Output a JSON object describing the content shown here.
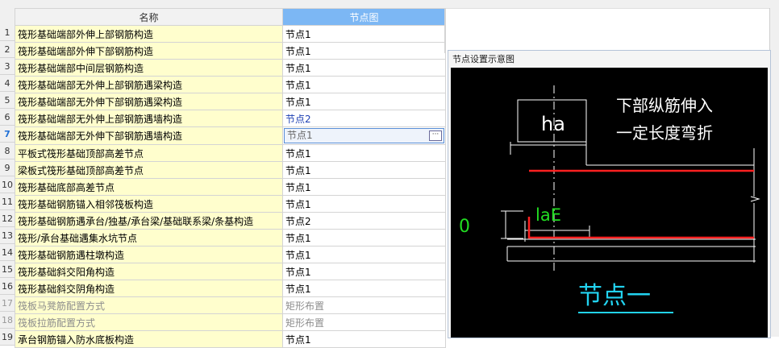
{
  "table": {
    "col_name": "名称",
    "col_node": "节点图",
    "rows": [
      {
        "num": "1",
        "name": "筏形基础端部外伸上部钢筋构造",
        "node": "节点1"
      },
      {
        "num": "2",
        "name": "筏形基础端部外伸下部钢筋构造",
        "node": "节点1"
      },
      {
        "num": "3",
        "name": "筏形基础端部中间层钢筋构造",
        "node": "节点1"
      },
      {
        "num": "4",
        "name": "筏形基础端部无外伸上部钢筋遇梁构造",
        "node": "节点1"
      },
      {
        "num": "5",
        "name": "筏形基础端部无外伸下部钢筋遇梁构造",
        "node": "节点1"
      },
      {
        "num": "6",
        "name": "筏形基础端部无外伸上部钢筋遇墙构造",
        "node": "节点2"
      },
      {
        "num": "7",
        "name": "筏形基础端部无外伸下部钢筋遇墙构造",
        "node": "节点1"
      },
      {
        "num": "8",
        "name": "平板式筏形基础顶部高差节点",
        "node": "节点1"
      },
      {
        "num": "9",
        "name": "梁板式筏形基础顶部高差节点",
        "node": "节点1"
      },
      {
        "num": "10",
        "name": "筏形基础底部高差节点",
        "node": "节点1"
      },
      {
        "num": "11",
        "name": "筏形基础钢筋锚入相邻筏板构造",
        "node": "节点1"
      },
      {
        "num": "12",
        "name": "筏形基础钢筋遇承台/独基/承台梁/基础联系梁/条基构造",
        "node": "节点2"
      },
      {
        "num": "13",
        "name": "筏形/承台基础遇集水坑节点",
        "node": "节点1"
      },
      {
        "num": "14",
        "name": "筏形基础钢筋遇柱墩构造",
        "node": "节点1"
      },
      {
        "num": "15",
        "name": "筏形基础斜交阳角构造",
        "node": "节点1"
      },
      {
        "num": "16",
        "name": "筏形基础斜交阴角构造",
        "node": "节点1"
      },
      {
        "num": "17",
        "name": "筏板马凳筋配置方式",
        "node": "矩形布置"
      },
      {
        "num": "18",
        "name": "筏板拉筋配置方式",
        "node": "矩形布置"
      },
      {
        "num": "19",
        "name": "承台钢筋锚入防水底板构造",
        "node": "节点1"
      }
    ]
  },
  "panel": {
    "title": "节点设置示意图",
    "diagram": {
      "label_ha": "ha",
      "caption_line1": "下部纵筋伸入",
      "caption_line2": "一定长度弯折",
      "label_lae": "laE",
      "label_zero": "0",
      "title": "节点一",
      "colors": {
        "white": "#ffffff",
        "red": "#ff2020",
        "green": "#22dd22",
        "cyan": "#22d3f0"
      }
    }
  },
  "states": {
    "selected_row": "7"
  }
}
